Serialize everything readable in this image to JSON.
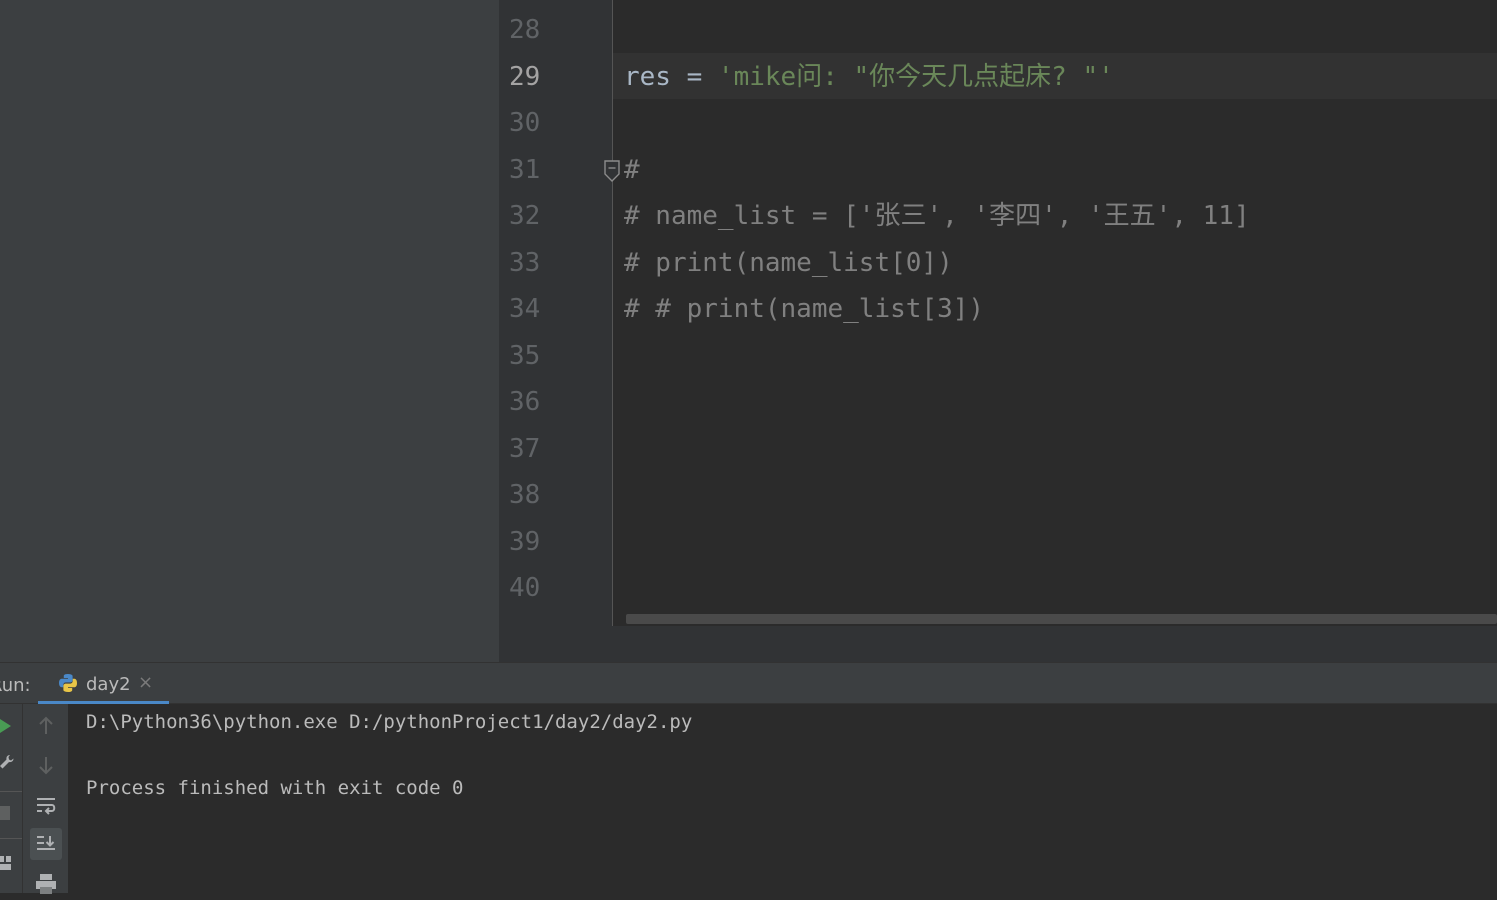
{
  "editor": {
    "line_numbers": [
      "28",
      "29",
      "30",
      "31",
      "32",
      "33",
      "34",
      "35",
      "36",
      "37",
      "38",
      "39",
      "40"
    ],
    "current_line": "29",
    "code": {
      "l29_kw": "res = ",
      "l29_str": "'mike问: \"你今天几点起床? \"'",
      "l31": "#",
      "l32": "# name_list = ['张三', '李四', '王五', 11]",
      "l33": "# print(name_list[0])",
      "l34": "# # print(name_list[3])"
    }
  },
  "run_panel": {
    "label": "Run:",
    "tab_title": "day2",
    "tab_close": "×",
    "console": {
      "command": "D:\\Python36\\python.exe D:/pythonProject1/day2/day2.py",
      "exit_message": "Process finished with exit code 0"
    }
  },
  "colors": {
    "editor_bg": "#2b2b2b",
    "panel_bg": "#3c3f41",
    "string": "#6a8759",
    "comment": "#808080",
    "run_green": "#499c54",
    "tab_accent": "#4a88c7"
  },
  "icons": [
    "python-file-icon",
    "run-icon",
    "wrench-icon",
    "stop-icon",
    "layout-icon",
    "scroll-up-icon",
    "scroll-down-icon",
    "soft-wrap-icon",
    "scroll-to-end-icon",
    "print-icon",
    "fold-icon"
  ]
}
